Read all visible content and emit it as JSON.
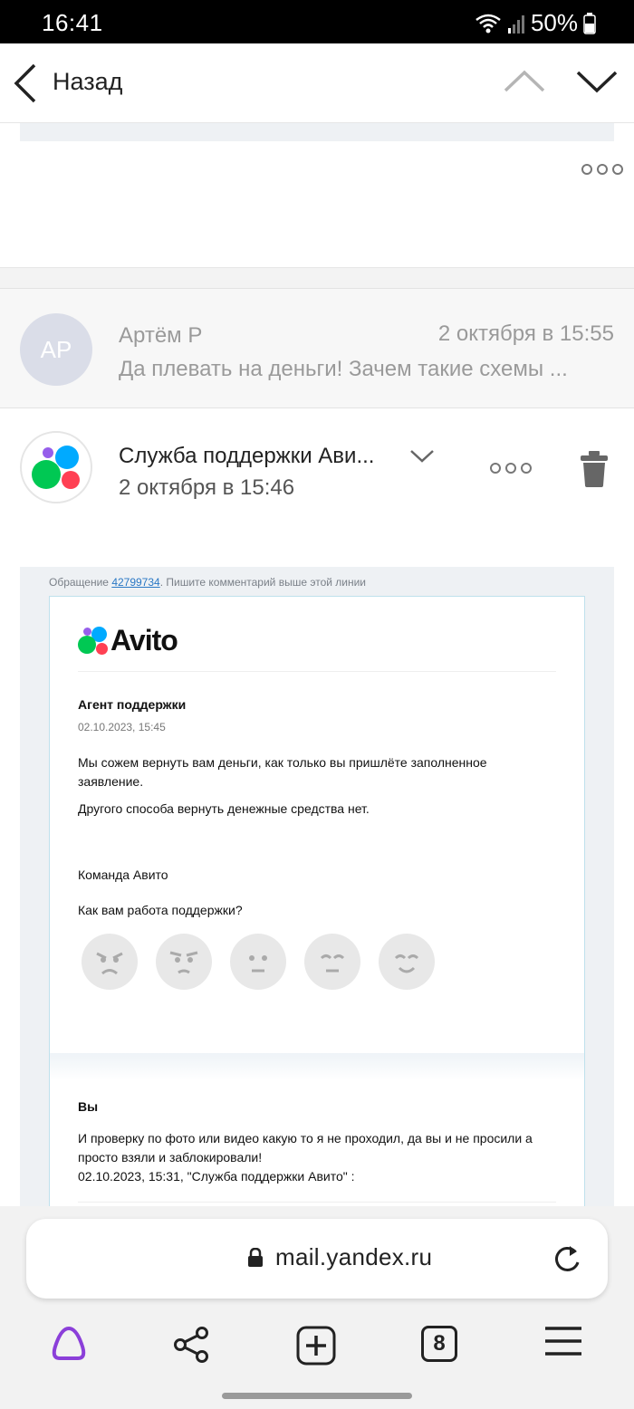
{
  "status_bar": {
    "time": "16:41",
    "battery": "50%"
  },
  "nav": {
    "back_label": "Назад"
  },
  "collapsed_message": {
    "avatar_initials": "АР",
    "sender": "Артём Р",
    "date": "2 октября в 15:55",
    "snippet": "Да плевать на деньги! Зачем такие схемы ..."
  },
  "expanded_message": {
    "sender": "Служба поддержки Ави...",
    "date": "2 октября в 15:46"
  },
  "email": {
    "ticket_prefix": "Обращение ",
    "ticket_number": "42799734",
    "ticket_suffix": ". Пишите комментарий выше этой линии",
    "logo_text": "Avito",
    "agent_label": "Агент поддержки",
    "agent_date": "02.10.2023, 15:45",
    "paragraph_1": "Мы сожем вернуть вам деньги, как только вы пришлёте заполненное заявление.",
    "paragraph_2": "Другого способа вернуть денежные средства нет.",
    "signature": "Команда Авито",
    "rate_question": "Как вам работа поддержки?",
    "rating_faces": [
      "angry-face-icon",
      "annoyed-face-icon",
      "neutral-face-icon",
      "content-face-icon",
      "happy-face-icon"
    ],
    "you_label": "Вы",
    "paragraph_3": "И проверку по фото или видео какую то я не проходил, да вы и не просили а просто взяли и заблокировали!",
    "quote_line": "02.10.2023, 15:31, \"Служба поддержки Авито\" :"
  },
  "browser": {
    "url": "mail.yandex.ru",
    "tab_count": "8"
  },
  "colors": {
    "alice": "#8b3fd9",
    "avito_green": "#00c853",
    "avito_blue": "#0af",
    "avito_red": "#ff4053",
    "avito_purple": "#965eeb",
    "link": "#2a78c5"
  }
}
